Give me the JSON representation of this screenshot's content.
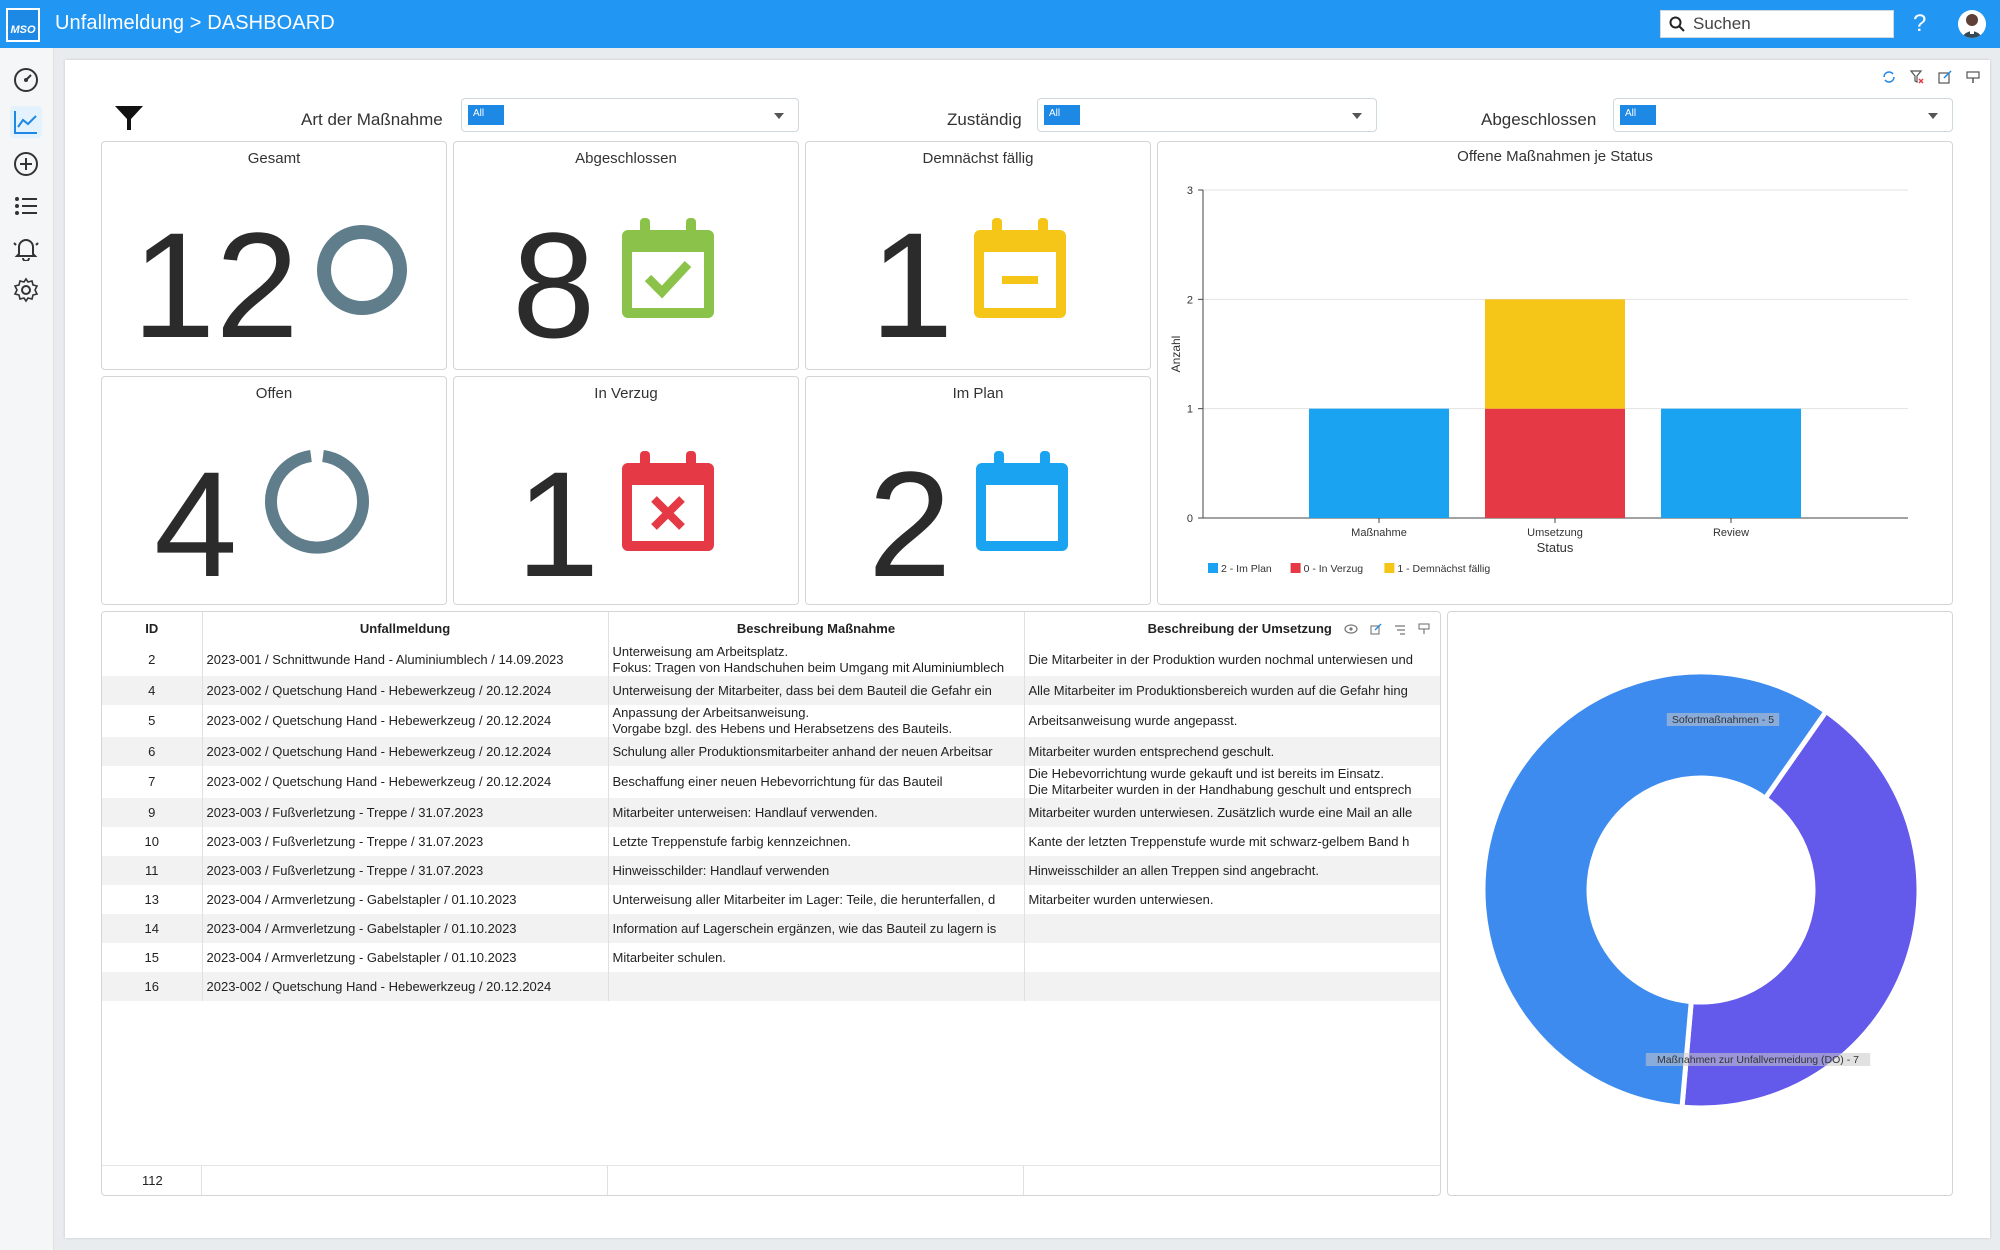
{
  "app": {
    "logo_text": "MSO",
    "title": "Unfallmeldung > DASHBOARD"
  },
  "search": {
    "placeholder": "Suchen"
  },
  "help": {
    "label": "?"
  },
  "filters": [
    {
      "label": "Art der Maßnahme",
      "value": "All"
    },
    {
      "label": "Zuständig",
      "value": "All"
    },
    {
      "label": "Abgeschlossen",
      "value": "All"
    }
  ],
  "kpis": {
    "gesamt": {
      "title": "Gesamt",
      "value": "12",
      "icon": "ring-icon",
      "color": "#607d8b"
    },
    "abgeschlossen": {
      "title": "Abgeschlossen",
      "value": "8",
      "icon": "calendar-check-icon",
      "color": "#8bc34a"
    },
    "demnaechst": {
      "title": "Demnächst fällig",
      "value": "1",
      "icon": "calendar-minus-icon",
      "color": "#f5c518"
    },
    "offen": {
      "title": "Offen",
      "value": "4",
      "icon": "ring-partial-icon",
      "color": "#607d8b"
    },
    "verzug": {
      "title": "In Verzug",
      "value": "1",
      "icon": "calendar-x-icon",
      "color": "#e53945"
    },
    "plan": {
      "title": "Im Plan",
      "value": "2",
      "icon": "calendar-empty-icon",
      "color": "#1aa3f0"
    }
  },
  "chart_data": [
    {
      "type": "bar",
      "stacked": true,
      "title": "Offene Maßnahmen je Status",
      "xlabel": "Status",
      "ylabel": "Anzahl",
      "categories": [
        "Maßnahme",
        "Umsetzung",
        "Review"
      ],
      "ylim": [
        0,
        3
      ],
      "yticks": [
        "0",
        "1",
        "2",
        "3"
      ],
      "grid": true,
      "legend_position": "bottom-left",
      "series": [
        {
          "name": "2 - Im Plan",
          "color": "#1aa3f0",
          "values": [
            1,
            0,
            1
          ]
        },
        {
          "name": "0 - In Verzug",
          "color": "#e53945",
          "values": [
            0,
            1,
            0
          ]
        },
        {
          "name": "1 - Demnächst fällig",
          "color": "#f5c518",
          "values": [
            0,
            1,
            0
          ]
        }
      ]
    },
    {
      "type": "pie",
      "donut": true,
      "slices": [
        {
          "label": "Sofortmaßnahmen - 5",
          "value": 5,
          "color": "#6359ea"
        },
        {
          "label": "Maßnahmen zur Unfallvermeidung (DO) - 7",
          "value": 7,
          "color": "#3d8bef"
        }
      ]
    }
  ],
  "table": {
    "headers": [
      "ID",
      "Unfallmeldung",
      "Beschreibung Maßnahme",
      "Beschreibung der Umsetzung"
    ],
    "rows": [
      {
        "id": "2",
        "meldung": "2023-001 / Schnittwunde Hand - Aluminiumblech / 14.09.2023",
        "massnahme": "Unterweisung am Arbeitsplatz.",
        "massnahme2": "Fokus: Tragen von Handschuhen beim Umgang mit Aluminiumblech",
        "umsetzung": "Die Mitarbeiter in der Produktion wurden nochmal unterwiesen und",
        "umsetzung2": ""
      },
      {
        "id": "4",
        "meldung": "2023-002 / Quetschung Hand - Hebewerkzeug / 20.12.2024",
        "massnahme": "Unterweisung der Mitarbeiter, dass bei dem Bauteil die Gefahr ein",
        "massnahme2": "",
        "umsetzung": "Alle Mitarbeiter im Produktionsbereich wurden auf die Gefahr hing",
        "umsetzung2": ""
      },
      {
        "id": "5",
        "meldung": "2023-002 / Quetschung Hand - Hebewerkzeug / 20.12.2024",
        "massnahme": "Anpassung der Arbeitsanweisung.",
        "massnahme2": "Vorgabe bzgl. des Hebens und Herabsetzens des Bauteils.",
        "umsetzung": "Arbeitsanweisung wurde angepasst.",
        "umsetzung2": ""
      },
      {
        "id": "6",
        "meldung": "2023-002 / Quetschung Hand - Hebewerkzeug / 20.12.2024",
        "massnahme": "Schulung aller Produktionsmitarbeiter anhand der neuen Arbeitsar",
        "massnahme2": "",
        "umsetzung": "Mitarbeiter wurden entsprechend geschult.",
        "umsetzung2": ""
      },
      {
        "id": "7",
        "meldung": "2023-002 / Quetschung Hand - Hebewerkzeug / 20.12.2024",
        "massnahme": "Beschaffung einer neuen Hebevorrichtung für das Bauteil",
        "massnahme2": "",
        "umsetzung": "Die Hebevorrichtung wurde gekauft und ist bereits im Einsatz.",
        "umsetzung2": "Die Mitarbeiter wurden in der Handhabung geschult und entsprech"
      },
      {
        "id": "9",
        "meldung": "2023-003 / Fußverletzung - Treppe / 31.07.2023",
        "massnahme": "Mitarbeiter unterweisen: Handlauf verwenden.",
        "massnahme2": "",
        "umsetzung": "Mitarbeiter wurden unterwiesen. Zusätzlich wurde eine Mail an alle",
        "umsetzung2": ""
      },
      {
        "id": "10",
        "meldung": "2023-003 / Fußverletzung - Treppe / 31.07.2023",
        "massnahme": "Letzte Treppenstufe farbig kennzeichnen.",
        "massnahme2": "",
        "umsetzung": "Kante der letzten Treppenstufe wurde mit schwarz-gelbem Band h",
        "umsetzung2": ""
      },
      {
        "id": "11",
        "meldung": "2023-003 / Fußverletzung - Treppe / 31.07.2023",
        "massnahme": "Hinweisschilder: Handlauf verwenden",
        "massnahme2": "",
        "umsetzung": "Hinweisschilder an allen Treppen sind angebracht.",
        "umsetzung2": ""
      },
      {
        "id": "13",
        "meldung": "2023-004 / Armverletzung - Gabelstapler / 01.10.2023",
        "massnahme": "Unterweisung aller Mitarbeiter im Lager: Teile, die herunterfallen, d",
        "massnahme2": "",
        "umsetzung": "Mitarbeiter wurden unterwiesen.",
        "umsetzung2": ""
      },
      {
        "id": "14",
        "meldung": "2023-004 / Armverletzung - Gabelstapler / 01.10.2023",
        "massnahme": "Information auf Lagerschein ergänzen, wie das Bauteil zu lagern is",
        "massnahme2": "",
        "umsetzung": "",
        "umsetzung2": ""
      },
      {
        "id": "15",
        "meldung": "2023-004 / Armverletzung - Gabelstapler / 01.10.2023",
        "massnahme": "Mitarbeiter schulen.",
        "massnahme2": "",
        "umsetzung": "",
        "umsetzung2": ""
      },
      {
        "id": "16",
        "meldung": "2023-002 / Quetschung Hand - Hebewerkzeug / 20.12.2024",
        "massnahme": "",
        "massnahme2": "",
        "umsetzung": "",
        "umsetzung2": ""
      }
    ],
    "footer_count": "112"
  }
}
